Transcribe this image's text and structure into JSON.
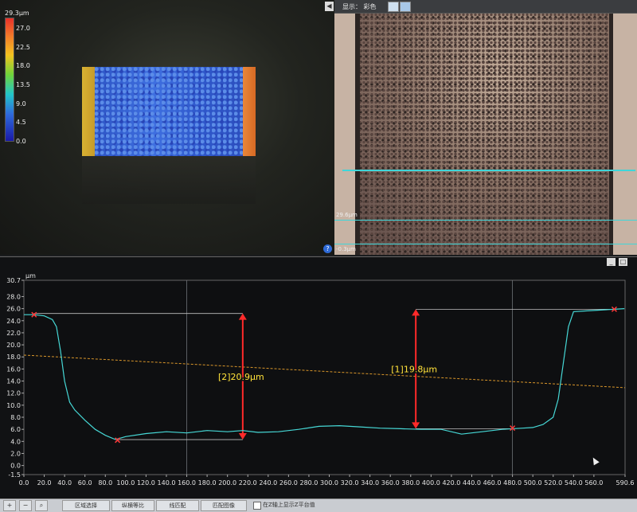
{
  "top_left": {
    "colorbar_max": "29.3μm",
    "colorbar_ticks": [
      "27.0",
      "22.5",
      "18.0",
      "13.5",
      "9.0",
      "4.5",
      "0.0"
    ],
    "help_icon": "?"
  },
  "top_right": {
    "display_label": "显示： 彩色",
    "collapse_glyph": "◀",
    "profile_top_label": "29.6μm",
    "profile_bottom_label": "-0.3μm"
  },
  "window": {
    "min_glyph": "_",
    "max_glyph": "□"
  },
  "chart_data": {
    "type": "line",
    "ylabel": "μm",
    "xlim": [
      0,
      590.6
    ],
    "ylim": [
      -1.5,
      30.7
    ],
    "x_ticks": [
      "0.0",
      "20.0",
      "40.0",
      "60.0",
      "80.0",
      "100.0",
      "120.0",
      "140.0",
      "160.0",
      "180.0",
      "200.0",
      "220.0",
      "240.0",
      "260.0",
      "280.0",
      "300.0",
      "320.0",
      "340.0",
      "360.0",
      "380.0",
      "400.0",
      "420.0",
      "440.0",
      "460.0",
      "480.0",
      "500.0",
      "520.0",
      "540.0",
      "560.0",
      "590.6"
    ],
    "y_ticks": [
      "30.7",
      "28.0",
      "26.0",
      "24.0",
      "22.0",
      "20.0",
      "18.0",
      "16.0",
      "14.0",
      "12.0",
      "10.0",
      "8.0",
      "6.0",
      "4.0",
      "2.0",
      "0.0",
      "-1.5"
    ],
    "profile": {
      "x": [
        0,
        10,
        20,
        28,
        32,
        36,
        40,
        45,
        50,
        60,
        70,
        80,
        90,
        100,
        120,
        140,
        160,
        180,
        200,
        215,
        230,
        250,
        270,
        290,
        310,
        330,
        350,
        370,
        390,
        410,
        430,
        450,
        470,
        490,
        500,
        510,
        520,
        525,
        530,
        535,
        540,
        550,
        560,
        570,
        580,
        590
      ],
      "y": [
        25.0,
        25.0,
        24.8,
        24.2,
        23.0,
        19.0,
        14.0,
        10.5,
        9.2,
        7.5,
        6.0,
        5.0,
        4.3,
        4.8,
        5.3,
        5.6,
        5.4,
        5.8,
        5.6,
        5.8,
        5.5,
        5.6,
        6.0,
        6.5,
        6.6,
        6.4,
        6.2,
        6.1,
        6.0,
        6.0,
        5.2,
        5.6,
        6.0,
        6.2,
        6.3,
        6.8,
        8.0,
        11.0,
        17.0,
        23.0,
        25.5,
        25.6,
        25.7,
        25.8,
        25.9,
        26.0
      ]
    },
    "markers": [
      {
        "x": 10,
        "y": 25.0
      },
      {
        "x": 92,
        "y": 4.2
      },
      {
        "x": 480,
        "y": 6.2
      },
      {
        "x": 580,
        "y": 25.9
      }
    ],
    "reference_line": {
      "x": [
        0,
        590.6
      ],
      "y": [
        18.3,
        12.9
      ]
    },
    "measurements": [
      {
        "label": "[2]20.9μm",
        "x": 215,
        "y_low": 4.3,
        "y_high": 25.2
      },
      {
        "label": "[1]19.8μm",
        "x": 385,
        "y_low": 6.1,
        "y_high": 25.9
      }
    ],
    "vertical_guides": [
      160,
      480
    ]
  },
  "toolbar": {
    "zoom_in": "+",
    "zoom_out": "−",
    "zoom_fit": "⌕",
    "region_select": "区域选择",
    "scale_equal": "纵横等比",
    "line_match": "线匹配",
    "match_image": "匹配图像",
    "show_z_plane": "在Z轴上显示Z平台值"
  }
}
